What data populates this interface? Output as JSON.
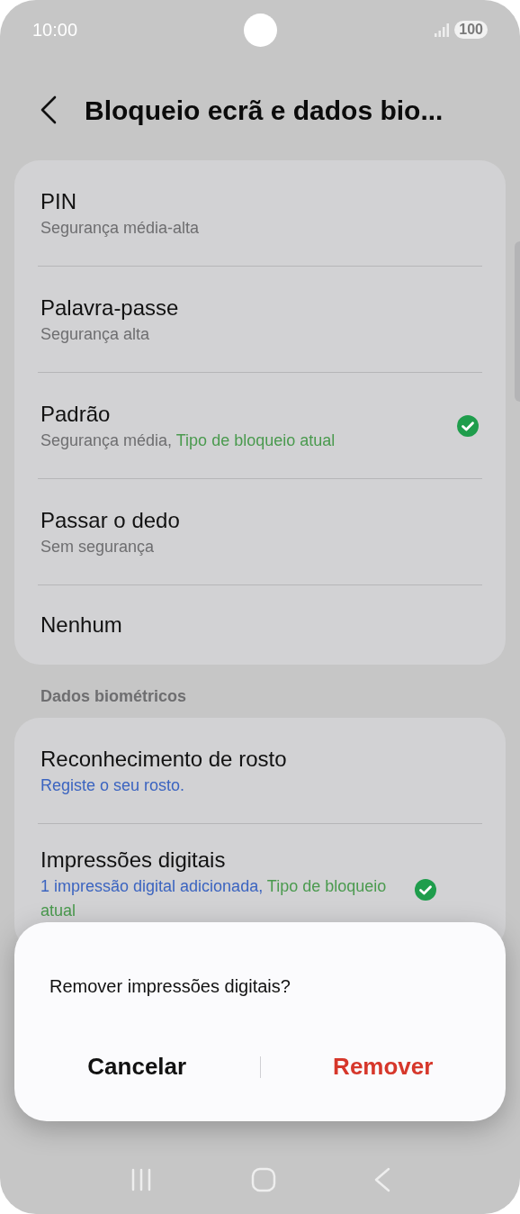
{
  "status_bar": {
    "time": "10:00",
    "battery": "100"
  },
  "header": {
    "title": "Bloqueio ecrã e dados bio..."
  },
  "lock_types": [
    {
      "title": "PIN",
      "subtitle": "Segurança média-alta",
      "checked": false
    },
    {
      "title": "Palavra-passe",
      "subtitle": "Segurança alta",
      "checked": false
    },
    {
      "title": "Padrão",
      "subtitle": "Segurança média,",
      "current": "Tipo de bloqueio atual",
      "checked": true
    },
    {
      "title": "Passar o dedo",
      "subtitle": "Sem segurança",
      "checked": false
    },
    {
      "title": "Nenhum",
      "checked": false
    }
  ],
  "biometrics": {
    "heading": "Dados biométricos",
    "items": [
      {
        "title": "Reconhecimento de rosto",
        "subtitle": "Registe o seu rosto.",
        "checked": false
      },
      {
        "title": "Impressões digitais",
        "subtitle": "1 impressão digital adicionada,",
        "current": "Tipo de bloqueio atual",
        "checked": true
      }
    ]
  },
  "dialog": {
    "message": "Remover impressões digitais?",
    "buttons": [
      {
        "label": "Cancelar",
        "kind": "neutral"
      },
      {
        "label": "Remover",
        "kind": "destructive"
      }
    ]
  }
}
